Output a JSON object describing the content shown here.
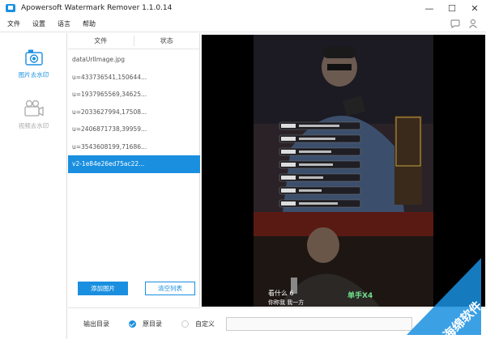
{
  "titlebar": {
    "title": "Apowersoft Watermark Remover 1.1.0.14",
    "minimize": "—",
    "maximize": "☐",
    "close": "✕"
  },
  "menu": {
    "file": "文件",
    "settings": "设置",
    "language": "语言",
    "help": "帮助"
  },
  "sidebar": {
    "image_label": "图片去水印",
    "video_label": "视频去水印"
  },
  "filepanel": {
    "col_file": "文件",
    "col_status": "状态",
    "files": [
      "dataUrlImage.jpg",
      "u=433736541,150644...",
      "u=1937965569,34625...",
      "u=2033627994,17508...",
      "u=2406871738,39959...",
      "u=3543608199,71686...",
      "v2-1e84e26ed75ac22..."
    ],
    "add_button": "添加图片",
    "clear_button": "清空列表"
  },
  "preview": {
    "caption_left": "看什么 6",
    "caption_left2": "你称我 我一方",
    "badge": "单手X4"
  },
  "bottombar": {
    "output_label": "输出目录",
    "opt_original": "原目录",
    "opt_custom": "自定义",
    "path_value": ""
  },
  "watermark": {
    "text": "海绵软件"
  },
  "colors": {
    "accent": "#1a8fe0"
  }
}
